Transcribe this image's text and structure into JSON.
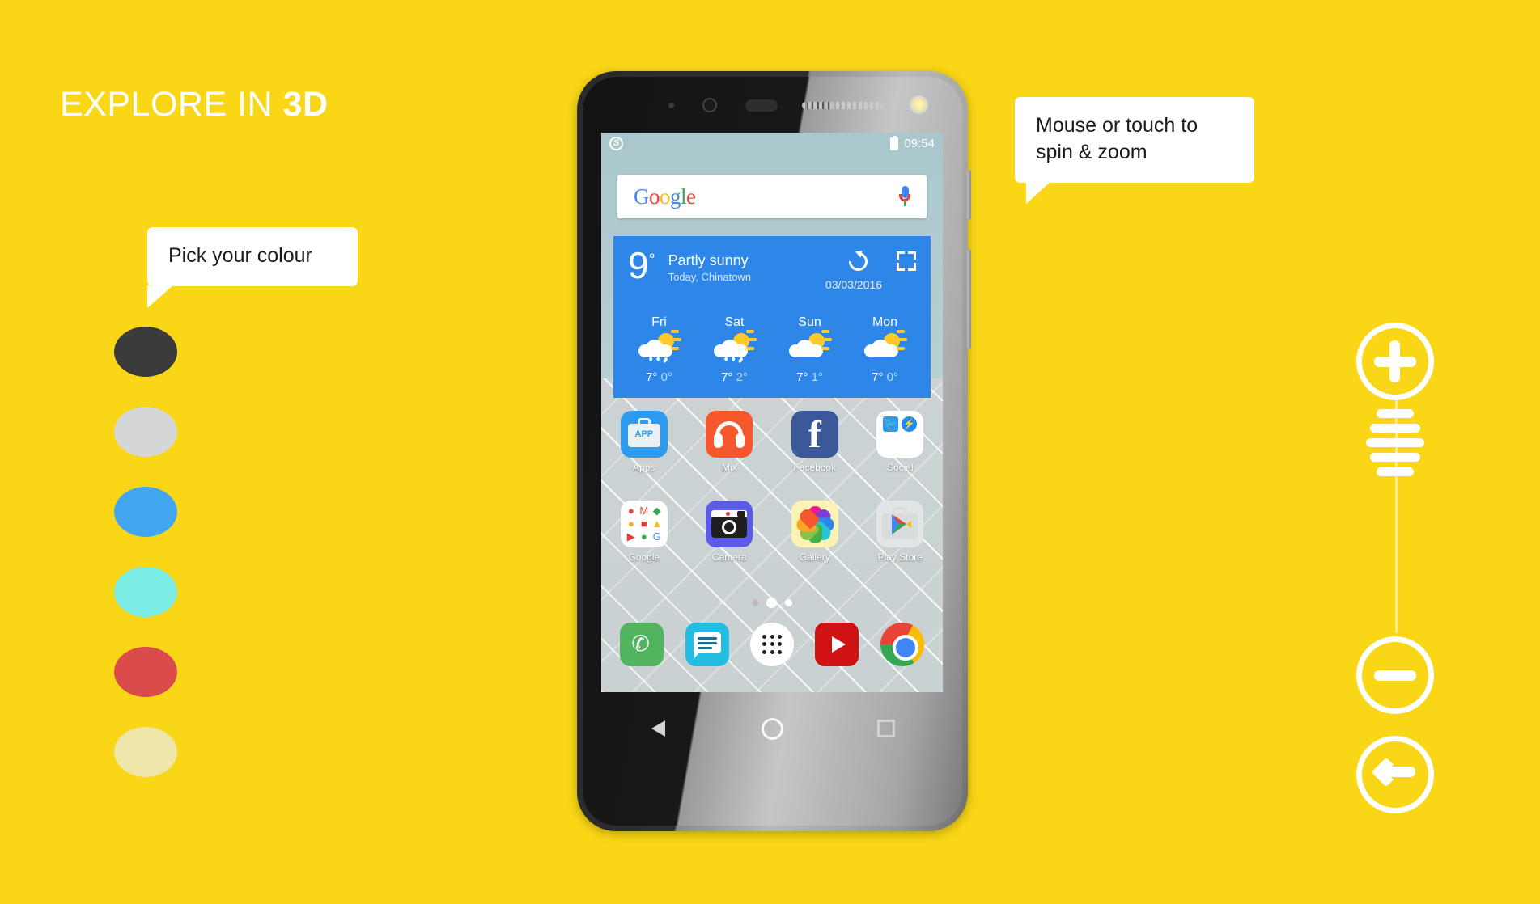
{
  "page": {
    "background_color": "#F9D616",
    "headline_prefix": "EXPLORE IN ",
    "headline_bold": "3D"
  },
  "tooltips": {
    "colour": "Pick your colour",
    "spin": "Mouse or touch to\nspin & zoom",
    "spin_line1": "Mouse or touch to",
    "spin_line2": "spin & zoom"
  },
  "swatches": [
    {
      "name": "dark-grey",
      "color": "#3A3A3C"
    },
    {
      "name": "light-grey",
      "color": "#D5D6D8"
    },
    {
      "name": "blue",
      "color": "#42A7EF"
    },
    {
      "name": "cyan",
      "color": "#7CEDE4"
    },
    {
      "name": "red",
      "color": "#DC4B4B"
    },
    {
      "name": "cream",
      "color": "#EEE6A8"
    }
  ],
  "controls": {
    "zoom_in": "+",
    "zoom_out": "−",
    "back": "←"
  },
  "phone": {
    "statusbar": {
      "carrier_icon": "s-circle-icon",
      "battery_icon": "battery-icon",
      "time": "09:54"
    },
    "search": {
      "logo_letters": [
        "G",
        "o",
        "o",
        "g",
        "l",
        "e"
      ],
      "mic_icon": "microphone-icon"
    },
    "weather": {
      "temperature": "9",
      "degree": "°",
      "condition": "Partly sunny",
      "location": "Today, Chinatown",
      "date": "03/03/2016",
      "refresh_icon": "refresh-icon",
      "expand_icon": "expand-icon",
      "accent_color": "#2E86E8",
      "forecast": [
        {
          "day": "Fri",
          "icon": "sun-cloud-rain",
          "high": "7°",
          "low": "0°"
        },
        {
          "day": "Sat",
          "icon": "sun-cloud-rain",
          "high": "7°",
          "low": "2°"
        },
        {
          "day": "Sun",
          "icon": "sun-cloud",
          "high": "7°",
          "low": "1°"
        },
        {
          "day": "Mon",
          "icon": "sun-cloud",
          "high": "7°",
          "low": "0°"
        }
      ]
    },
    "apps_row1": [
      {
        "label": "Apps",
        "icon": "apps-briefcase-icon",
        "badge": "APP"
      },
      {
        "label": "Mix",
        "icon": "headphones-icon"
      },
      {
        "label": "Facebook",
        "icon": "facebook-icon",
        "glyph": "f"
      },
      {
        "label": "Social",
        "icon": "social-folder-icon"
      }
    ],
    "apps_row2": [
      {
        "label": "Google",
        "icon": "google-folder-icon"
      },
      {
        "label": "Camera",
        "icon": "camera-icon"
      },
      {
        "label": "Gallery",
        "icon": "gallery-pinwheel-icon"
      },
      {
        "label": "Play Store",
        "icon": "play-store-icon"
      }
    ],
    "google_folder_glyphs": [
      "●",
      "M",
      "◆",
      "●",
      "■",
      "▲",
      "▶",
      "●",
      "G"
    ],
    "page_dots": [
      "diamond",
      "active",
      "inactive"
    ],
    "dock": [
      {
        "label": "Phone",
        "icon": "phone-icon",
        "glyph": "✆"
      },
      {
        "label": "Messages",
        "icon": "messages-icon"
      },
      {
        "label": "App drawer",
        "icon": "app-drawer-icon"
      },
      {
        "label": "YouTube",
        "icon": "youtube-icon"
      },
      {
        "label": "Chrome",
        "icon": "chrome-icon"
      }
    ],
    "navbar": [
      {
        "label": "Back",
        "icon": "nav-back-icon"
      },
      {
        "label": "Home",
        "icon": "nav-home-icon"
      },
      {
        "label": "Recents",
        "icon": "nav-recents-icon"
      }
    ]
  }
}
